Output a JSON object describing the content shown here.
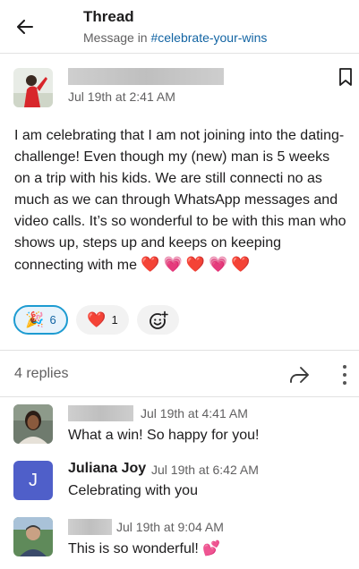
{
  "header": {
    "title": "Thread",
    "subtitle_prefix": "Message in",
    "channel": "#celebrate-your-wins"
  },
  "parent": {
    "timestamp": "Jul 19th at 2:41 AM",
    "body": "I am celebrating that I am not joining into the dating-challenge! Even though my (new) man is 5 weeks on a trip with his kids. We are still connecti no as much as we can through WhatsApp messages and video calls. It’s so wonderful to be with this man who shows up, steps up and keeps on keeping connecting with me",
    "hearts": [
      "❤️",
      "💗",
      "❤️",
      "💗",
      "❤️"
    ],
    "reactions": [
      {
        "emoji": "🎉",
        "count": "6"
      },
      {
        "emoji": "❤️",
        "count": "1"
      }
    ],
    "add_reaction_icon": "add-emoji-icon"
  },
  "thread": {
    "replies_label": "4 replies"
  },
  "replies": [
    {
      "name": "",
      "time": "Jul 19th at 4:41 AM",
      "text": "What a win! So happy for you!"
    },
    {
      "name": "Juliana Joy",
      "initial": "J",
      "time": "Jul 19th at 6:42 AM",
      "text": "Celebrating with you"
    },
    {
      "name": "",
      "time": "Jul 19th at 9:04 AM",
      "text": "This is so wonderful!",
      "emoji": "💕"
    }
  ],
  "colors": {
    "accent": "#1264a3",
    "reaction_active_border": "#1d9bd1",
    "initial_avatar": "#4f5fc9"
  }
}
